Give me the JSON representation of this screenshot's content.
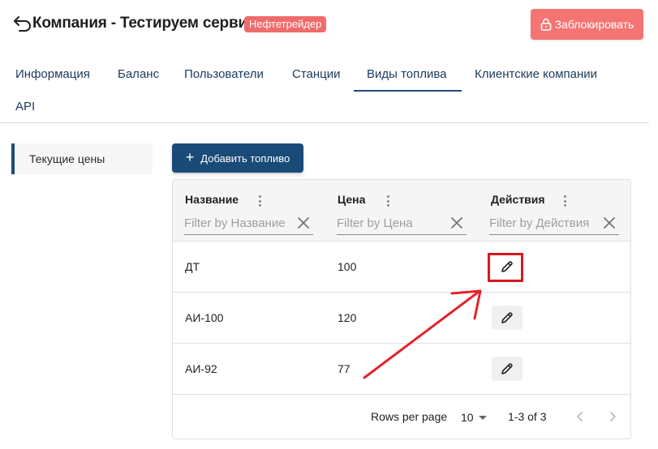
{
  "header": {
    "title": "Компания - Тестируем сервис",
    "company_badge": "Нефтетрейдер",
    "block_button_label": "Заблокировать",
    "back_icon": "undo-arrow-icon",
    "lock_icon": "lock-icon"
  },
  "tabs": [
    {
      "label": "Информация",
      "active": false
    },
    {
      "label": "Баланс",
      "active": false
    },
    {
      "label": "Пользователи",
      "active": false
    },
    {
      "label": "Станции",
      "active": false
    },
    {
      "label": "Виды топлива",
      "active": true
    },
    {
      "label": "Клиентские компании",
      "active": false
    },
    {
      "label": "API",
      "active": false
    }
  ],
  "subnav": {
    "items": [
      {
        "label": "Текущие цены",
        "active": true
      }
    ]
  },
  "toolbar": {
    "add_label": "Добавить топливо"
  },
  "table": {
    "columns": [
      {
        "header": "Название",
        "filter_placeholder": "Filter by Название"
      },
      {
        "header": "Цена",
        "filter_placeholder": "Filter by Цена"
      },
      {
        "header": "Действия",
        "filter_placeholder": "Filter by Действия"
      }
    ],
    "rows": [
      {
        "name": "ДТ",
        "price": "100"
      },
      {
        "name": "АИ-100",
        "price": "120"
      },
      {
        "name": "АИ-92",
        "price": "77"
      }
    ],
    "highlighted_row": 0
  },
  "pagination": {
    "rows_per_page_label": "Rows per page",
    "rows_per_page_value": "10",
    "range_label": "1-3 of 3"
  },
  "colors": {
    "primary": "#1a4a78",
    "danger": "#f47474",
    "badge": "#f06b6b",
    "annotation": "#d7191f"
  }
}
